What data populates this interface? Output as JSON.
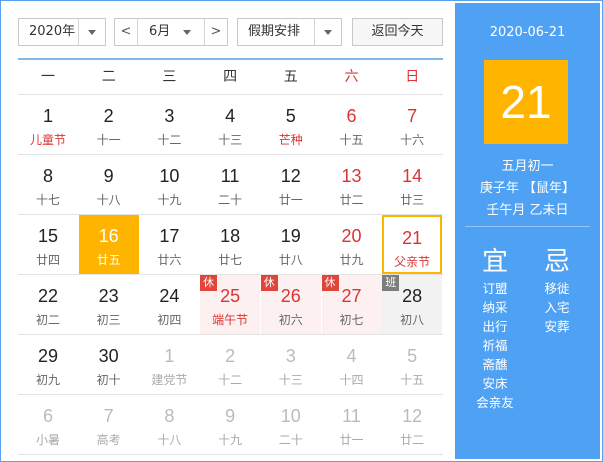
{
  "toolbar": {
    "year": "2020年",
    "prev": "<",
    "month": "6月",
    "next": ">",
    "holiday": "假期安排",
    "today": "返回今天"
  },
  "weekdays": [
    "一",
    "二",
    "三",
    "四",
    "五",
    "六",
    "日"
  ],
  "weeks": [
    [
      {
        "n": "1",
        "s": "儿童节",
        "t": "festival"
      },
      {
        "n": "2",
        "s": "十一"
      },
      {
        "n": "3",
        "s": "十二"
      },
      {
        "n": "4",
        "s": "十三"
      },
      {
        "n": "5",
        "s": "芒种",
        "t": "festival"
      },
      {
        "n": "6",
        "s": "十五",
        "t": "wkend"
      },
      {
        "n": "7",
        "s": "十六",
        "t": "wkend"
      }
    ],
    [
      {
        "n": "8",
        "s": "十七"
      },
      {
        "n": "9",
        "s": "十八"
      },
      {
        "n": "10",
        "s": "十九"
      },
      {
        "n": "11",
        "s": "二十"
      },
      {
        "n": "12",
        "s": "廿一"
      },
      {
        "n": "13",
        "s": "廿二",
        "t": "wkend"
      },
      {
        "n": "14",
        "s": "廿三",
        "t": "wkend"
      }
    ],
    [
      {
        "n": "15",
        "s": "廿四"
      },
      {
        "n": "16",
        "s": "廿五",
        "t": "selected"
      },
      {
        "n": "17",
        "s": "廿六"
      },
      {
        "n": "18",
        "s": "廿七"
      },
      {
        "n": "19",
        "s": "廿八"
      },
      {
        "n": "20",
        "s": "廿九",
        "t": "wkend"
      },
      {
        "n": "21",
        "s": "父亲节",
        "t": "wkend festival todayc"
      }
    ],
    [
      {
        "n": "22",
        "s": "初二"
      },
      {
        "n": "23",
        "s": "初三"
      },
      {
        "n": "24",
        "s": "初四"
      },
      {
        "n": "25",
        "s": "端午节",
        "t": "rest festival",
        "b": "休"
      },
      {
        "n": "26",
        "s": "初六",
        "t": "rest",
        "b": "休"
      },
      {
        "n": "27",
        "s": "初七",
        "t": "rest",
        "b": "休"
      },
      {
        "n": "28",
        "s": "初八",
        "t": "workday",
        "b": "班"
      }
    ],
    [
      {
        "n": "29",
        "s": "初九"
      },
      {
        "n": "30",
        "s": "初十"
      },
      {
        "n": "1",
        "s": "建党节",
        "t": "other"
      },
      {
        "n": "2",
        "s": "十二",
        "t": "other"
      },
      {
        "n": "3",
        "s": "十三",
        "t": "other"
      },
      {
        "n": "4",
        "s": "十四",
        "t": "other"
      },
      {
        "n": "5",
        "s": "十五",
        "t": "other"
      }
    ],
    [
      {
        "n": "6",
        "s": "小暑",
        "t": "other"
      },
      {
        "n": "7",
        "s": "高考",
        "t": "other"
      },
      {
        "n": "8",
        "s": "十八",
        "t": "other"
      },
      {
        "n": "9",
        "s": "十九",
        "t": "other"
      },
      {
        "n": "10",
        "s": "二十",
        "t": "other"
      },
      {
        "n": "11",
        "s": "廿一",
        "t": "other"
      },
      {
        "n": "12",
        "s": "廿二",
        "t": "other"
      }
    ]
  ],
  "panel": {
    "date": "2020-06-21",
    "day": "21",
    "lunar_month_day": "五月初一",
    "ganzhi_year": "庚子年 【鼠年】",
    "ganzhi_month_day": "壬午月 乙未日",
    "yi_title": "宜",
    "ji_title": "忌",
    "yi": [
      "订盟",
      "纳采",
      "出行",
      "祈福",
      "斋醮",
      "安床",
      "会亲友"
    ],
    "ji": [
      "移徙",
      "入宅",
      "安葬"
    ]
  },
  "colors": {
    "accent": "#ffb400",
    "panel": "#4fa2f3",
    "red": "#dd3333"
  }
}
